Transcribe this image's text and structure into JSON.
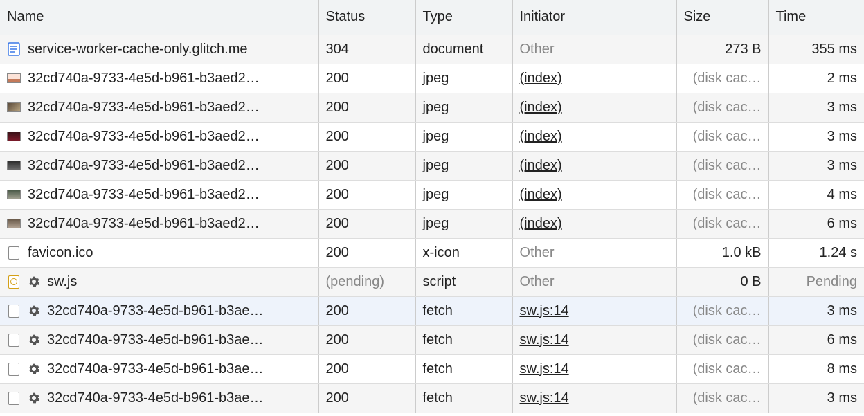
{
  "columns": {
    "name": "Name",
    "status": "Status",
    "type": "Type",
    "initiator": "Initiator",
    "size": "Size",
    "time": "Time"
  },
  "rows": [
    {
      "icon": "doc",
      "gear": false,
      "name": "service-worker-cache-only.glitch.me",
      "status": "304",
      "statusMuted": false,
      "type": "document",
      "initiator": "Other",
      "initiatorLink": false,
      "size": "273 B",
      "sizeMuted": false,
      "time": "355 ms",
      "timeMuted": false,
      "alt": true,
      "sel": false
    },
    {
      "icon": "img1",
      "gear": false,
      "name": "32cd740a-9733-4e5d-b961-b3aed2…",
      "status": "200",
      "statusMuted": false,
      "type": "jpeg",
      "initiator": "(index)",
      "initiatorLink": true,
      "size": "(disk cac…",
      "sizeMuted": true,
      "time": "2 ms",
      "timeMuted": false,
      "alt": false,
      "sel": false
    },
    {
      "icon": "img2",
      "gear": false,
      "name": "32cd740a-9733-4e5d-b961-b3aed2…",
      "status": "200",
      "statusMuted": false,
      "type": "jpeg",
      "initiator": "(index)",
      "initiatorLink": true,
      "size": "(disk cac…",
      "sizeMuted": true,
      "time": "3 ms",
      "timeMuted": false,
      "alt": true,
      "sel": false
    },
    {
      "icon": "img3",
      "gear": false,
      "name": "32cd740a-9733-4e5d-b961-b3aed2…",
      "status": "200",
      "statusMuted": false,
      "type": "jpeg",
      "initiator": "(index)",
      "initiatorLink": true,
      "size": "(disk cac…",
      "sizeMuted": true,
      "time": "3 ms",
      "timeMuted": false,
      "alt": false,
      "sel": false
    },
    {
      "icon": "img4",
      "gear": false,
      "name": "32cd740a-9733-4e5d-b961-b3aed2…",
      "status": "200",
      "statusMuted": false,
      "type": "jpeg",
      "initiator": "(index)",
      "initiatorLink": true,
      "size": "(disk cac…",
      "sizeMuted": true,
      "time": "3 ms",
      "timeMuted": false,
      "alt": true,
      "sel": false
    },
    {
      "icon": "img5",
      "gear": false,
      "name": "32cd740a-9733-4e5d-b961-b3aed2…",
      "status": "200",
      "statusMuted": false,
      "type": "jpeg",
      "initiator": "(index)",
      "initiatorLink": true,
      "size": "(disk cac…",
      "sizeMuted": true,
      "time": "4 ms",
      "timeMuted": false,
      "alt": false,
      "sel": false
    },
    {
      "icon": "img6",
      "gear": false,
      "name": "32cd740a-9733-4e5d-b961-b3aed2…",
      "status": "200",
      "statusMuted": false,
      "type": "jpeg",
      "initiator": "(index)",
      "initiatorLink": true,
      "size": "(disk cac…",
      "sizeMuted": true,
      "time": "6 ms",
      "timeMuted": false,
      "alt": true,
      "sel": false
    },
    {
      "icon": "blank",
      "gear": false,
      "name": "favicon.ico",
      "status": "200",
      "statusMuted": false,
      "type": "x-icon",
      "initiator": "Other",
      "initiatorLink": false,
      "size": "1.0 kB",
      "sizeMuted": false,
      "time": "1.24 s",
      "timeMuted": false,
      "alt": false,
      "sel": false
    },
    {
      "icon": "blankg",
      "gear": true,
      "name": "sw.js",
      "status": "(pending)",
      "statusMuted": true,
      "type": "script",
      "initiator": "Other",
      "initiatorLink": false,
      "size": "0 B",
      "sizeMuted": false,
      "time": "Pending",
      "timeMuted": true,
      "alt": true,
      "sel": false
    },
    {
      "icon": "blank",
      "gear": true,
      "name": "32cd740a-9733-4e5d-b961-b3ae…",
      "status": "200",
      "statusMuted": false,
      "type": "fetch",
      "initiator": "sw.js:14",
      "initiatorLink": true,
      "size": "(disk cac…",
      "sizeMuted": true,
      "time": "3 ms",
      "timeMuted": false,
      "alt": false,
      "sel": true
    },
    {
      "icon": "blank",
      "gear": true,
      "name": "32cd740a-9733-4e5d-b961-b3ae…",
      "status": "200",
      "statusMuted": false,
      "type": "fetch",
      "initiator": "sw.js:14",
      "initiatorLink": true,
      "size": "(disk cac…",
      "sizeMuted": true,
      "time": "6 ms",
      "timeMuted": false,
      "alt": true,
      "sel": false
    },
    {
      "icon": "blank",
      "gear": true,
      "name": "32cd740a-9733-4e5d-b961-b3ae…",
      "status": "200",
      "statusMuted": false,
      "type": "fetch",
      "initiator": "sw.js:14",
      "initiatorLink": true,
      "size": "(disk cac…",
      "sizeMuted": true,
      "time": "8 ms",
      "timeMuted": false,
      "alt": false,
      "sel": false
    },
    {
      "icon": "blank",
      "gear": true,
      "name": "32cd740a-9733-4e5d-b961-b3ae…",
      "status": "200",
      "statusMuted": false,
      "type": "fetch",
      "initiator": "sw.js:14",
      "initiatorLink": true,
      "size": "(disk cac…",
      "sizeMuted": true,
      "time": "3 ms",
      "timeMuted": false,
      "alt": true,
      "sel": false
    }
  ]
}
